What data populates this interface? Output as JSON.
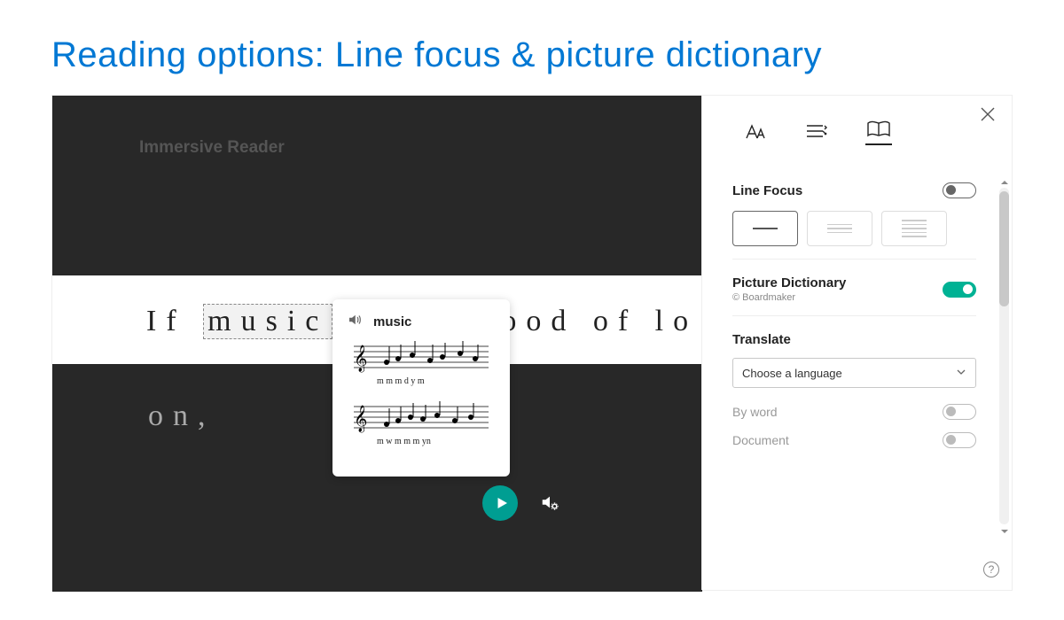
{
  "slide": {
    "title": "Reading options: Line focus & picture dictionary"
  },
  "reader": {
    "label": "Immersive Reader",
    "line1_prefix": "If ",
    "line1_word": "music",
    "line1_suffix": "ood of lo",
    "line2": "on,"
  },
  "popup": {
    "word": "music"
  },
  "panel": {
    "line_focus": {
      "label": "Line Focus"
    },
    "picture_dictionary": {
      "label": "Picture Dictionary",
      "attribution": "© Boardmaker"
    },
    "translate": {
      "label": "Translate",
      "placeholder": "Choose a language",
      "by_word": "By word",
      "document": "Document"
    }
  }
}
